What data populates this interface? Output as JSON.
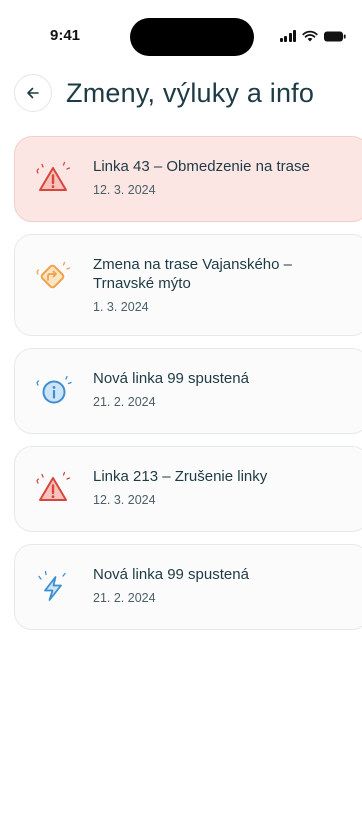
{
  "status_bar": {
    "time": "9:41"
  },
  "header": {
    "title": "Zmeny, výluky a info"
  },
  "items": [
    {
      "title": "Linka 43 – Obmedzenie na trase",
      "date": "12. 3. 2024",
      "icon": "warning-triangle-icon"
    },
    {
      "title": "Zmena na trase Vajanského – Trnavské mýto",
      "date": "1. 3. 2024",
      "icon": "route-change-icon"
    },
    {
      "title": "Nová linka 99 spustená",
      "date": "21. 2. 2024",
      "icon": "info-circle-icon"
    },
    {
      "title": "Linka 213 – Zrušenie linky",
      "date": "12. 3. 2024",
      "icon": "warning-triangle-icon"
    },
    {
      "title": "Nová linka 99 spustená",
      "date": "21. 2. 2024",
      "icon": "lightning-icon"
    }
  ],
  "colors": {
    "alert_bg": "#fbe6e3",
    "warning_red": "#d9463b",
    "route_orange": "#f0a24a",
    "info_blue": "#3c8fd0",
    "text_dark": "#1e3a44"
  }
}
